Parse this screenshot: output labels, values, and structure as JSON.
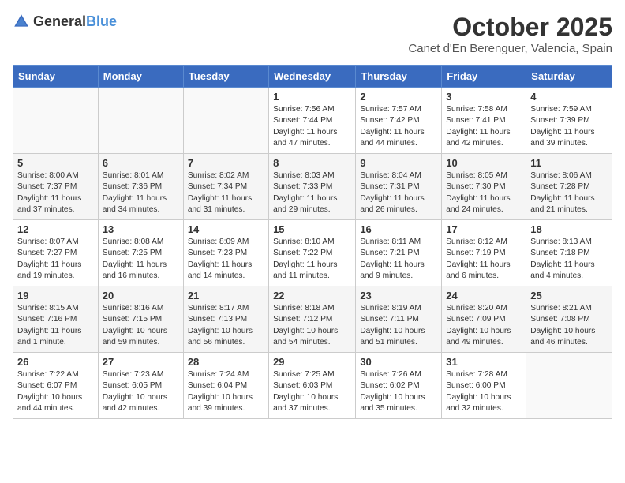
{
  "header": {
    "logo_general": "General",
    "logo_blue": "Blue",
    "month_year": "October 2025",
    "location": "Canet d'En Berenguer, Valencia, Spain"
  },
  "days_of_week": [
    "Sunday",
    "Monday",
    "Tuesday",
    "Wednesday",
    "Thursday",
    "Friday",
    "Saturday"
  ],
  "weeks": [
    [
      {
        "day": "",
        "sunrise": "",
        "sunset": "",
        "daylight": ""
      },
      {
        "day": "",
        "sunrise": "",
        "sunset": "",
        "daylight": ""
      },
      {
        "day": "",
        "sunrise": "",
        "sunset": "",
        "daylight": ""
      },
      {
        "day": "1",
        "sunrise": "Sunrise: 7:56 AM",
        "sunset": "Sunset: 7:44 PM",
        "daylight": "Daylight: 11 hours and 47 minutes."
      },
      {
        "day": "2",
        "sunrise": "Sunrise: 7:57 AM",
        "sunset": "Sunset: 7:42 PM",
        "daylight": "Daylight: 11 hours and 44 minutes."
      },
      {
        "day": "3",
        "sunrise": "Sunrise: 7:58 AM",
        "sunset": "Sunset: 7:41 PM",
        "daylight": "Daylight: 11 hours and 42 minutes."
      },
      {
        "day": "4",
        "sunrise": "Sunrise: 7:59 AM",
        "sunset": "Sunset: 7:39 PM",
        "daylight": "Daylight: 11 hours and 39 minutes."
      }
    ],
    [
      {
        "day": "5",
        "sunrise": "Sunrise: 8:00 AM",
        "sunset": "Sunset: 7:37 PM",
        "daylight": "Daylight: 11 hours and 37 minutes."
      },
      {
        "day": "6",
        "sunrise": "Sunrise: 8:01 AM",
        "sunset": "Sunset: 7:36 PM",
        "daylight": "Daylight: 11 hours and 34 minutes."
      },
      {
        "day": "7",
        "sunrise": "Sunrise: 8:02 AM",
        "sunset": "Sunset: 7:34 PM",
        "daylight": "Daylight: 11 hours and 31 minutes."
      },
      {
        "day": "8",
        "sunrise": "Sunrise: 8:03 AM",
        "sunset": "Sunset: 7:33 PM",
        "daylight": "Daylight: 11 hours and 29 minutes."
      },
      {
        "day": "9",
        "sunrise": "Sunrise: 8:04 AM",
        "sunset": "Sunset: 7:31 PM",
        "daylight": "Daylight: 11 hours and 26 minutes."
      },
      {
        "day": "10",
        "sunrise": "Sunrise: 8:05 AM",
        "sunset": "Sunset: 7:30 PM",
        "daylight": "Daylight: 11 hours and 24 minutes."
      },
      {
        "day": "11",
        "sunrise": "Sunrise: 8:06 AM",
        "sunset": "Sunset: 7:28 PM",
        "daylight": "Daylight: 11 hours and 21 minutes."
      }
    ],
    [
      {
        "day": "12",
        "sunrise": "Sunrise: 8:07 AM",
        "sunset": "Sunset: 7:27 PM",
        "daylight": "Daylight: 11 hours and 19 minutes."
      },
      {
        "day": "13",
        "sunrise": "Sunrise: 8:08 AM",
        "sunset": "Sunset: 7:25 PM",
        "daylight": "Daylight: 11 hours and 16 minutes."
      },
      {
        "day": "14",
        "sunrise": "Sunrise: 8:09 AM",
        "sunset": "Sunset: 7:23 PM",
        "daylight": "Daylight: 11 hours and 14 minutes."
      },
      {
        "day": "15",
        "sunrise": "Sunrise: 8:10 AM",
        "sunset": "Sunset: 7:22 PM",
        "daylight": "Daylight: 11 hours and 11 minutes."
      },
      {
        "day": "16",
        "sunrise": "Sunrise: 8:11 AM",
        "sunset": "Sunset: 7:21 PM",
        "daylight": "Daylight: 11 hours and 9 minutes."
      },
      {
        "day": "17",
        "sunrise": "Sunrise: 8:12 AM",
        "sunset": "Sunset: 7:19 PM",
        "daylight": "Daylight: 11 hours and 6 minutes."
      },
      {
        "day": "18",
        "sunrise": "Sunrise: 8:13 AM",
        "sunset": "Sunset: 7:18 PM",
        "daylight": "Daylight: 11 hours and 4 minutes."
      }
    ],
    [
      {
        "day": "19",
        "sunrise": "Sunrise: 8:15 AM",
        "sunset": "Sunset: 7:16 PM",
        "daylight": "Daylight: 11 hours and 1 minute."
      },
      {
        "day": "20",
        "sunrise": "Sunrise: 8:16 AM",
        "sunset": "Sunset: 7:15 PM",
        "daylight": "Daylight: 10 hours and 59 minutes."
      },
      {
        "day": "21",
        "sunrise": "Sunrise: 8:17 AM",
        "sunset": "Sunset: 7:13 PM",
        "daylight": "Daylight: 10 hours and 56 minutes."
      },
      {
        "day": "22",
        "sunrise": "Sunrise: 8:18 AM",
        "sunset": "Sunset: 7:12 PM",
        "daylight": "Daylight: 10 hours and 54 minutes."
      },
      {
        "day": "23",
        "sunrise": "Sunrise: 8:19 AM",
        "sunset": "Sunset: 7:11 PM",
        "daylight": "Daylight: 10 hours and 51 minutes."
      },
      {
        "day": "24",
        "sunrise": "Sunrise: 8:20 AM",
        "sunset": "Sunset: 7:09 PM",
        "daylight": "Daylight: 10 hours and 49 minutes."
      },
      {
        "day": "25",
        "sunrise": "Sunrise: 8:21 AM",
        "sunset": "Sunset: 7:08 PM",
        "daylight": "Daylight: 10 hours and 46 minutes."
      }
    ],
    [
      {
        "day": "26",
        "sunrise": "Sunrise: 7:22 AM",
        "sunset": "Sunset: 6:07 PM",
        "daylight": "Daylight: 10 hours and 44 minutes."
      },
      {
        "day": "27",
        "sunrise": "Sunrise: 7:23 AM",
        "sunset": "Sunset: 6:05 PM",
        "daylight": "Daylight: 10 hours and 42 minutes."
      },
      {
        "day": "28",
        "sunrise": "Sunrise: 7:24 AM",
        "sunset": "Sunset: 6:04 PM",
        "daylight": "Daylight: 10 hours and 39 minutes."
      },
      {
        "day": "29",
        "sunrise": "Sunrise: 7:25 AM",
        "sunset": "Sunset: 6:03 PM",
        "daylight": "Daylight: 10 hours and 37 minutes."
      },
      {
        "day": "30",
        "sunrise": "Sunrise: 7:26 AM",
        "sunset": "Sunset: 6:02 PM",
        "daylight": "Daylight: 10 hours and 35 minutes."
      },
      {
        "day": "31",
        "sunrise": "Sunrise: 7:28 AM",
        "sunset": "Sunset: 6:00 PM",
        "daylight": "Daylight: 10 hours and 32 minutes."
      },
      {
        "day": "",
        "sunrise": "",
        "sunset": "",
        "daylight": ""
      }
    ]
  ]
}
